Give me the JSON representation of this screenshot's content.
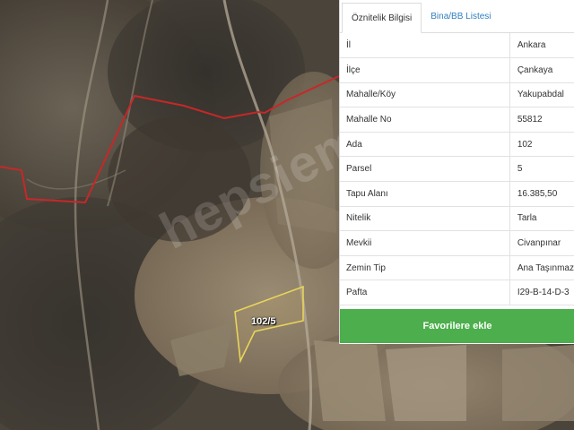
{
  "map": {
    "watermark": "hepsiemlak",
    "parcel_label": "102/5",
    "colors": {
      "boundary": "#c62828",
      "parcel_outline": "#e8d45a",
      "field": "#8a7d68",
      "dark": "#3f3b35"
    }
  },
  "panel": {
    "tabs": [
      {
        "label": "Öznitelik Bilgisi",
        "active": true
      },
      {
        "label": "Bina/BB Listesi",
        "active": false
      }
    ],
    "rows": [
      {
        "key": "İl",
        "value": "Ankara"
      },
      {
        "key": "İlçe",
        "value": "Çankaya"
      },
      {
        "key": "Mahalle/Köy",
        "value": "Yakupabdal"
      },
      {
        "key": "Mahalle No",
        "value": "55812"
      },
      {
        "key": "Ada",
        "value": "102"
      },
      {
        "key": "Parsel",
        "value": "5"
      },
      {
        "key": "Tapu Alanı",
        "value": "16.385,50"
      },
      {
        "key": "Nitelik",
        "value": "Tarla"
      },
      {
        "key": "Mevkii",
        "value": "Civanpınar"
      },
      {
        "key": "Zemin Tip",
        "value": "Ana Taşınmaz"
      },
      {
        "key": "Pafta",
        "value": "I29-B-14-D-3"
      }
    ],
    "favorite_button": "Favorilere ekle",
    "colors": {
      "button": "#4cae4c",
      "tab_link": "#2f7fc1"
    }
  }
}
